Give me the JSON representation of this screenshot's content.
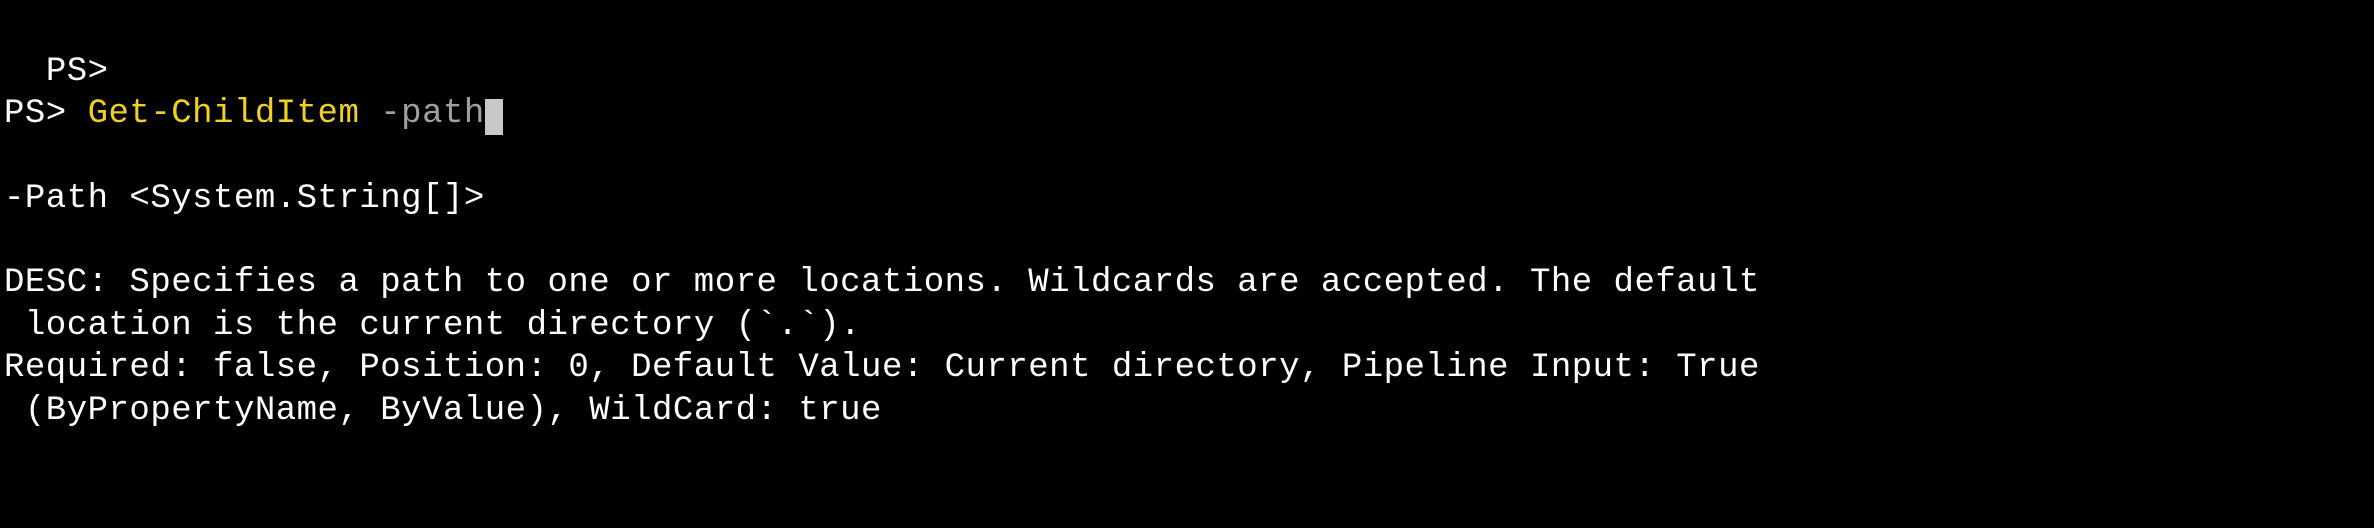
{
  "line1": {
    "prompt": "PS>"
  },
  "line2": {
    "prompt": "PS> ",
    "command": "Get-ChildItem",
    "space": " ",
    "param": "-path"
  },
  "help": {
    "signature": "-Path <System.String[]>",
    "desc_line1": "DESC: Specifies a path to one or more locations. Wildcards are accepted. The default",
    "desc_line2": " location is the current directory (`.`).",
    "attrs_line1": "Required: false, Position: 0, Default Value: Current directory, Pipeline Input: True",
    "attrs_line2": " (ByPropertyName, ByValue), WildCard: true"
  }
}
